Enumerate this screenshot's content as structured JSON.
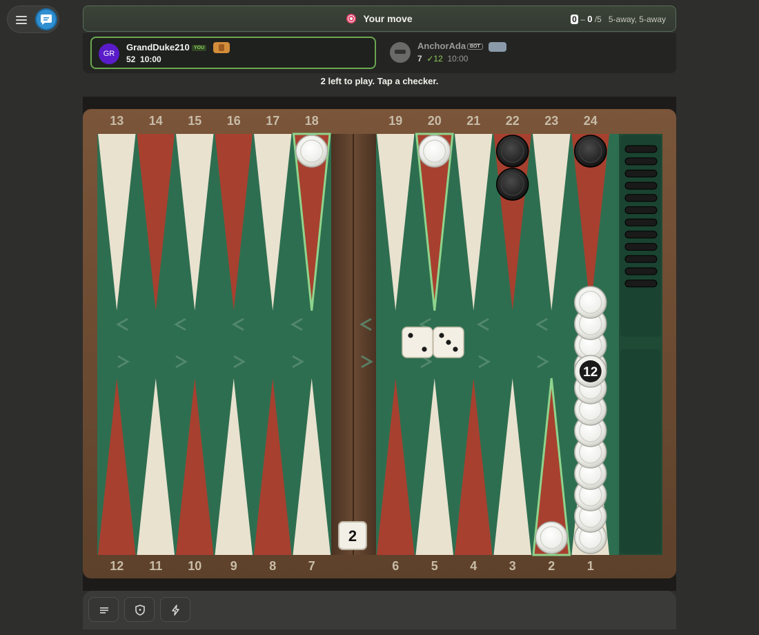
{
  "status": {
    "message": "Your move",
    "score_you": "0",
    "score_sep": "–",
    "score_opp": "0",
    "match_length": "/5",
    "away_text": "5-away, 5-away"
  },
  "player_you": {
    "avatar_initials": "GR",
    "name": "GrandDuke210",
    "tag": "YOU",
    "pips": "52",
    "clock": "10:00"
  },
  "player_opp": {
    "name": "AnchorAda",
    "tag": "BOT",
    "pips": "7",
    "pip_check": "✓12",
    "clock": "10:00"
  },
  "hint": "2 left to play. Tap a checker.",
  "board": {
    "top_points": [
      "13",
      "14",
      "15",
      "16",
      "17",
      "18",
      "19",
      "20",
      "21",
      "22",
      "23",
      "24"
    ],
    "bottom_points": [
      "12",
      "11",
      "10",
      "9",
      "8",
      "7",
      "6",
      "5",
      "4",
      "3",
      "2",
      "1"
    ],
    "dice": [
      2,
      3
    ],
    "cube_value": "2",
    "stack_count_label": "12",
    "borne_off_opp": 12,
    "highlighted_points": [
      18,
      20,
      2
    ],
    "checkers": [
      {
        "point": 18,
        "color": "white",
        "count": 1
      },
      {
        "point": 20,
        "color": "white",
        "count": 1
      },
      {
        "point": 22,
        "color": "black",
        "count": 2
      },
      {
        "point": 24,
        "color": "black",
        "count": 1
      },
      {
        "point": 2,
        "color": "white",
        "count": 1
      },
      {
        "point": 1,
        "color": "white",
        "count": 12
      }
    ],
    "colors": {
      "felt": "#2e6e50",
      "red_point": "#a8402f",
      "cream_point": "#e9e2cf",
      "frame": "#6b4a33",
      "highlight": "#8fd48c"
    }
  },
  "toolbar": {
    "buttons": [
      "list-icon",
      "shield-icon",
      "bolt-icon"
    ]
  }
}
